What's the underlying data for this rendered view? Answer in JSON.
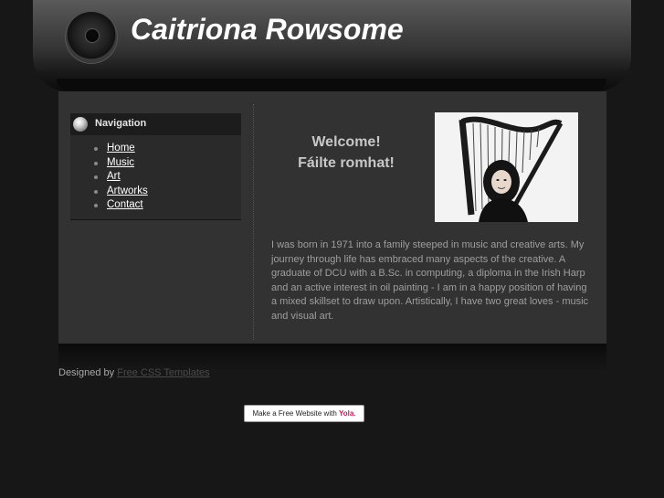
{
  "header": {
    "title": "Caitriona Rowsome"
  },
  "nav": {
    "title": "Navigation",
    "items": [
      {
        "label": "Home"
      },
      {
        "label": "Music"
      },
      {
        "label": "Art"
      },
      {
        "label": "Artworks"
      },
      {
        "label": "Contact"
      }
    ]
  },
  "main": {
    "welcome_en": "Welcome!",
    "welcome_ga": "Fáilte romhat!",
    "bio": "I was born in 1971 into a family steeped in music and creative arts. My journey through life has embraced many aspects of the creative. A graduate of DCU with  a B.Sc. in computing, a diploma in the Irish Harp and an active interest in oil painting - I am in a happy position of having a mixed skillset to draw upon. Artistically, I have two great loves - music and visual art."
  },
  "footer": {
    "credit_prefix": "Designed by ",
    "credit_link": "Free CSS Templates"
  },
  "badge": {
    "text": "Make a Free Website with ",
    "brand": "Yola",
    "brand_color": "#d4145a",
    "suffix": "."
  }
}
